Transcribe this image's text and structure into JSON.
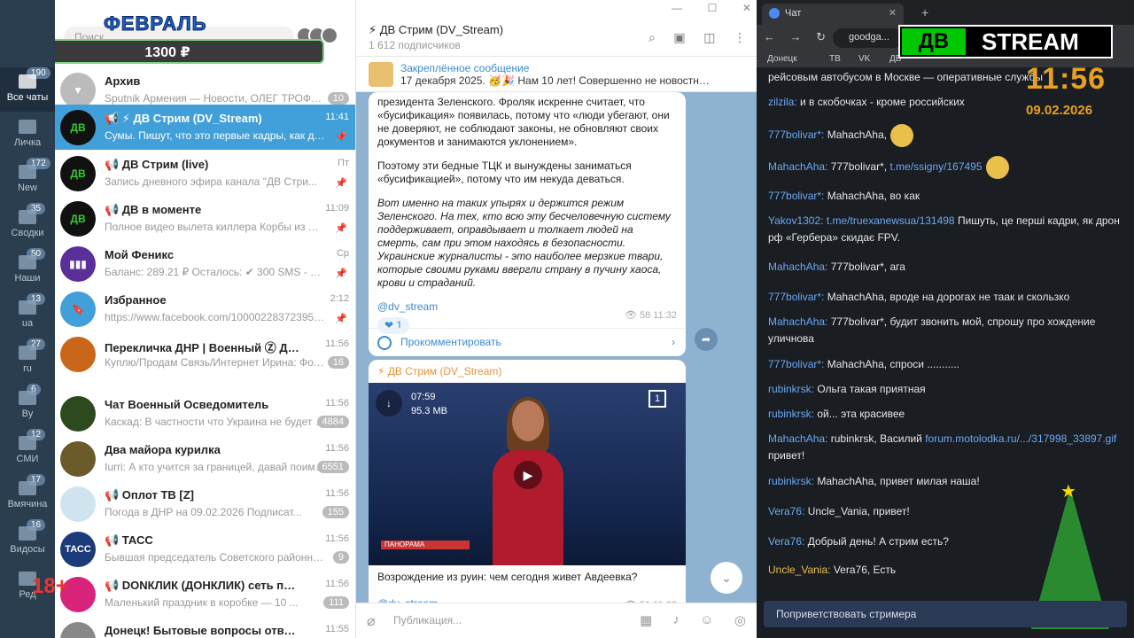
{
  "folders": [
    {
      "label": "Все чаты",
      "badge": "190"
    },
    {
      "label": "Личка",
      "badge": ""
    },
    {
      "label": "New",
      "badge": "172"
    },
    {
      "label": "Сводки",
      "badge": "35"
    },
    {
      "label": "Наши",
      "badge": "50"
    },
    {
      "label": "ua",
      "badge": "13"
    },
    {
      "label": "ru",
      "badge": "27"
    },
    {
      "label": "By",
      "badge": "6"
    },
    {
      "label": "СМИ",
      "badge": "12"
    },
    {
      "label": "Вмячина",
      "badge": "17"
    },
    {
      "label": "Видосы",
      "badge": "16"
    },
    {
      "label": "Ред",
      "badge": ""
    }
  ],
  "overlay": {
    "month": "ФЕВРАЛЬ",
    "price": "1300 ₽",
    "age": "18+"
  },
  "search": {
    "placeholder": "Поиск"
  },
  "chats": [
    {
      "title": "Архив",
      "time": "",
      "preview": "Sputnik Армения — Новости, ОЛЕГ ТРОФИМ...",
      "badge": "10",
      "avatar": ""
    },
    {
      "title": "📢 ⚡ ДВ Стрим (DV_Stream)",
      "time": "11:41",
      "preview": "Сумы. Пишут, что это первые кадры, как др...",
      "badge": "",
      "avatar": "ДВ"
    },
    {
      "title": "📢 ДВ Стрим (live)",
      "time": "Пт",
      "preview": "Запись дневного эфира канала \"ДВ Стри...",
      "badge": "",
      "avatar": "ДВ"
    },
    {
      "title": "📢 ДВ в моменте",
      "time": "11:09",
      "preview": "Полное видео вылета киллера Корбы из Мо...",
      "badge": "",
      "avatar": "ДВ"
    },
    {
      "title": "Мой Феникс",
      "time": "Ср",
      "preview": "Баланс: 289.21 ₽ Осталось: ✔ 300 SMS - 300 SM...",
      "badge": "",
      "avatar": ""
    },
    {
      "title": "Избранное",
      "time": "2:12",
      "preview": "https://www.facebook.com/100002283723955/po...",
      "badge": "",
      "avatar": ""
    },
    {
      "title": "Перекличка ДНР | Военный Ⓩ Донецк",
      "time": "11:56",
      "preview": "Куплю/Продам  Связь/Интернет  Ирина: Фотография",
      "badge": "16",
      "avatar": ""
    },
    {
      "title": "Чат Военный Осведомитель",
      "time": "11:56",
      "preview": "Каскад: В частности что Украина не будет вх...",
      "badge": "4884",
      "avatar": ""
    },
    {
      "title": "Два майора курилка",
      "time": "11:56",
      "preview": "Iurri: А кто учится за границей, давай поиме...",
      "badge": "6551",
      "avatar": ""
    },
    {
      "title": "📢 Оплот ТВ [Z]",
      "time": "11:56",
      "preview": "Погода в ДНР на 09.02.2026  Подписат...",
      "badge": "155",
      "avatar": ""
    },
    {
      "title": "📢 ТАСС",
      "time": "11:56",
      "preview": "Бывшая председатель Советского районно...",
      "badge": "9",
      "avatar": "ТАСС"
    },
    {
      "title": "📢 DONКЛИК (ДОНКЛИК) сеть пунктов выд...",
      "time": "11:56",
      "preview": "Маленький праздник в коробке — 10 ...",
      "badge": "111",
      "avatar": ""
    },
    {
      "title": "Донецк! Бытовые вопросы ответы:",
      "time": "11:55",
      "preview": "",
      "badge": "",
      "avatar": ""
    }
  ],
  "channel": {
    "title": "⚡ ДВ Стрим (DV_Stream)",
    "subscribers": "1 612 подписчиков",
    "pinned_label": "Закреплённое сообщение",
    "pinned_text": "17 декабря 2025. 🥳🎉 Нам 10 лет! Совершенно не новостной, н...",
    "post1": {
      "p1": "президента Зеленского. Фроляк искренне считает, что «бусификация» появилась, потому что «люди убегают, они не доверяют, не соблюдают законы, не обновляют своих документов и занимаются уклонением».",
      "p2": "Поэтому эти бедные ТЦК и вынуждены заниматься «бусификацией», потому что им некуда деваться.",
      "p3": "Вот именно на таких упырях и держится режим Зеленского. На тех, кто всю эту бесчеловечную систему поддерживает, оправдывает и толкает людей на смерть, сам при этом находясь в безопасности. Украинские журналисты - это наиболее мерзкие твари, которые своими руками ввергли страну в пучину хаоса, крови и страданий.",
      "tag": "@dv_stream",
      "reaction": "❤ 1",
      "views": "👁 58  11:32",
      "comment": "Прокомментировать"
    },
    "post2": {
      "author": "⚡ ДВ Стрим (DV_Stream)",
      "duration": "07:59",
      "size": "95.3 MB",
      "counter": "1",
      "logo": "ПАНОРАМА",
      "title": "Возрождение из руин: чем сегодня живет Авдеевка?",
      "tag": "@dv_stream",
      "views": "👁 51  11:32"
    },
    "composer_placeholder": "Публикация..."
  },
  "browser": {
    "tab_title": "Чат",
    "url": "goodga...",
    "bookmarks": [
      "Донецк",
      "ТВ",
      "VK",
      "ДВ"
    ],
    "logo_dv": "ДВ",
    "logo_stream": "STREAM",
    "clock": "11:56",
    "date": "09.02.2026",
    "send_label": "Поприветствовать стримера",
    "messages": [
      {
        "user": "",
        "text": "рейсовым автобусом в Москве — оперативные службы"
      },
      {
        "user": "zilzila:",
        "text": "и в скобочках - кроме российских"
      },
      {
        "user": "777bolivar*:",
        "text": "MahachAha,"
      },
      {
        "user": "MahachAha:",
        "text": "777bolivar*,",
        "link": "t.me/ssigny/167495"
      },
      {
        "user": "777bolivar*:",
        "text": "MahachAha, во как"
      },
      {
        "user": "Yakov1302:",
        "text": "Пишуть, це перші кадри, як дрон рф «Гербера» скидає FPV.",
        "link": "t.me/truexanewsua/131498"
      },
      {
        "user": "MahachAha:",
        "text": "777bolivar*,  ага"
      },
      {
        "user": "777bolivar*:",
        "text": "MahachAha, вроде на дорогах не таак и скользко"
      },
      {
        "user": "MahachAha:",
        "text": "777bolivar*, будит звонить мой, спрошу про хождение уличнова"
      },
      {
        "user": "777bolivar*:",
        "text": "MahachAha, спроси ..........."
      },
      {
        "user": "rubinkrsk:",
        "text": "Ольга такая приятная"
      },
      {
        "user": "rubinkrsk:",
        "text": "ой... эта красивее"
      },
      {
        "user": "MahachAha:",
        "text": "rubinkrsk, Василий",
        "link": "forum.motolodka.ru/.../317998_33897.gif",
        "tail": "привет!"
      },
      {
        "user": "rubinkrsk:",
        "text": "MahachAha, привет милая наша!"
      },
      {
        "user": "Vera76:",
        "text": "Uncle_Vania, привет!"
      },
      {
        "user": "Vera76:",
        "text": "Добрый день! А стрим есть?"
      },
      {
        "user": "Uncle_Vania:",
        "text": "Vera76,  Есть"
      }
    ]
  }
}
